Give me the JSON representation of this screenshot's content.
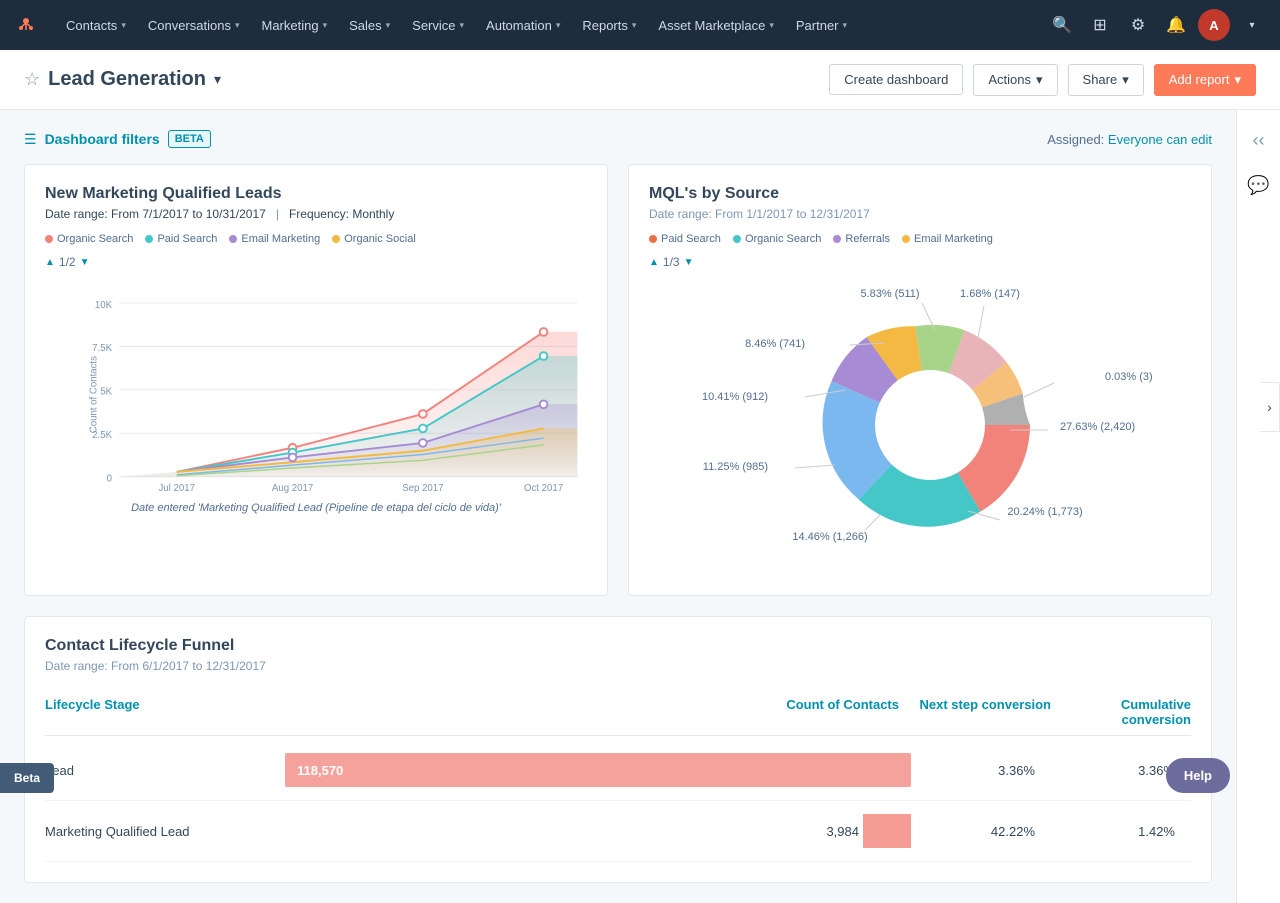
{
  "nav": {
    "items": [
      {
        "label": "Contacts",
        "id": "contacts"
      },
      {
        "label": "Conversations",
        "id": "conversations"
      },
      {
        "label": "Marketing",
        "id": "marketing"
      },
      {
        "label": "Sales",
        "id": "sales"
      },
      {
        "label": "Service",
        "id": "service"
      },
      {
        "label": "Automation",
        "id": "automation"
      },
      {
        "label": "Reports",
        "id": "reports"
      },
      {
        "label": "Asset Marketplace",
        "id": "asset-marketplace"
      },
      {
        "label": "Partner",
        "id": "partner"
      }
    ]
  },
  "page": {
    "title": "Lead Generation",
    "assigned_label": "Assigned:",
    "assigned_link": "Everyone can edit"
  },
  "buttons": {
    "create_dashboard": "Create dashboard",
    "actions": "Actions",
    "share": "Share",
    "add_report": "Add report"
  },
  "filters": {
    "label": "Dashboard filters",
    "badge": "BETA"
  },
  "chart1": {
    "title": "New Marketing Qualified Leads",
    "date_range": "Date range: From 7/1/2017 to 10/31/2017",
    "frequency": "Frequency: Monthly",
    "page": "1/2",
    "y_axis_label": "Count of Contacts",
    "x_axis_label": "Date entered 'Marketing Qualified Lead (Pipeline de etapa del ciclo de vida)'",
    "y_ticks": [
      "0",
      "2.5K",
      "5K",
      "7.5K",
      "10K"
    ],
    "x_ticks": [
      "Jul 2017",
      "Aug 2017",
      "Sep 2017",
      "Oct 2017"
    ],
    "legend": [
      {
        "label": "Organic Search",
        "color": "#f2837b"
      },
      {
        "label": "Paid Search",
        "color": "#45c7c7"
      },
      {
        "label": "Email Marketing",
        "color": "#a78bd4"
      },
      {
        "label": "Organic Social",
        "color": "#f4b942"
      }
    ]
  },
  "chart2": {
    "title": "MQL's by Source",
    "date_range": "Date range: From 1/1/2017 to 12/31/2017",
    "page": "1/3",
    "legend": [
      {
        "label": "Paid Search",
        "color": "#e8724a"
      },
      {
        "label": "Organic Search",
        "color": "#45c7c7"
      },
      {
        "label": "Referrals",
        "color": "#a78bd4"
      },
      {
        "label": "Email Marketing",
        "color": "#f4b942"
      }
    ],
    "segments": [
      {
        "label": "27.63% (2,420)",
        "pct": 27.63,
        "color": "#f2837b",
        "angle": 0
      },
      {
        "label": "20.24% (1,773)",
        "pct": 20.24,
        "color": "#45c7c7",
        "angle": 99
      },
      {
        "label": "14.46% (1,266)",
        "pct": 14.46,
        "color": "#7bb8f0",
        "angle": 172
      },
      {
        "label": "11.25% (985)",
        "pct": 11.25,
        "color": "#a78bd4",
        "angle": 224
      },
      {
        "label": "10.41% (912)",
        "pct": 10.41,
        "color": "#f4b942",
        "angle": 265
      },
      {
        "label": "8.46% (741)",
        "pct": 8.46,
        "color": "#a8d48a",
        "angle": 302
      },
      {
        "label": "5.83% (511)",
        "pct": 5.83,
        "color": "#e8b4b8",
        "angle": 333
      },
      {
        "label": "1.68% (147)",
        "pct": 1.68,
        "color": "#f7c07a",
        "angle": 354
      },
      {
        "label": "0.03% (3)",
        "pct": 0.03,
        "color": "#b0b0b0",
        "angle": 360
      }
    ]
  },
  "funnel": {
    "title": "Contact Lifecycle Funnel",
    "date_range": "Date range: From 6/1/2017 to 12/31/2017",
    "headers": {
      "stage": "Lifecycle Stage",
      "count": "Count of Contacts",
      "next_step": "Next step conversion",
      "cumulative": "Cumulative conversion"
    },
    "rows": [
      {
        "stage": "Lead",
        "count": "118,570",
        "count_raw": 118570,
        "next_step": "3.36%",
        "cumulative": "3.36%",
        "bar_color": "#f2837b",
        "bar_pct": 100
      },
      {
        "stage": "Marketing Qualified Lead",
        "count": "3,984",
        "count_raw": 3984,
        "next_step": "42.22%",
        "cumulative": "1.42%",
        "bar_color": "#f2837b",
        "bar_pct": 3.4
      }
    ]
  },
  "beta_label": "Beta",
  "help_label": "Help",
  "colors": {
    "primary": "#ff7a59",
    "link": "#0091ae",
    "nav_bg": "#1e2d3d"
  }
}
